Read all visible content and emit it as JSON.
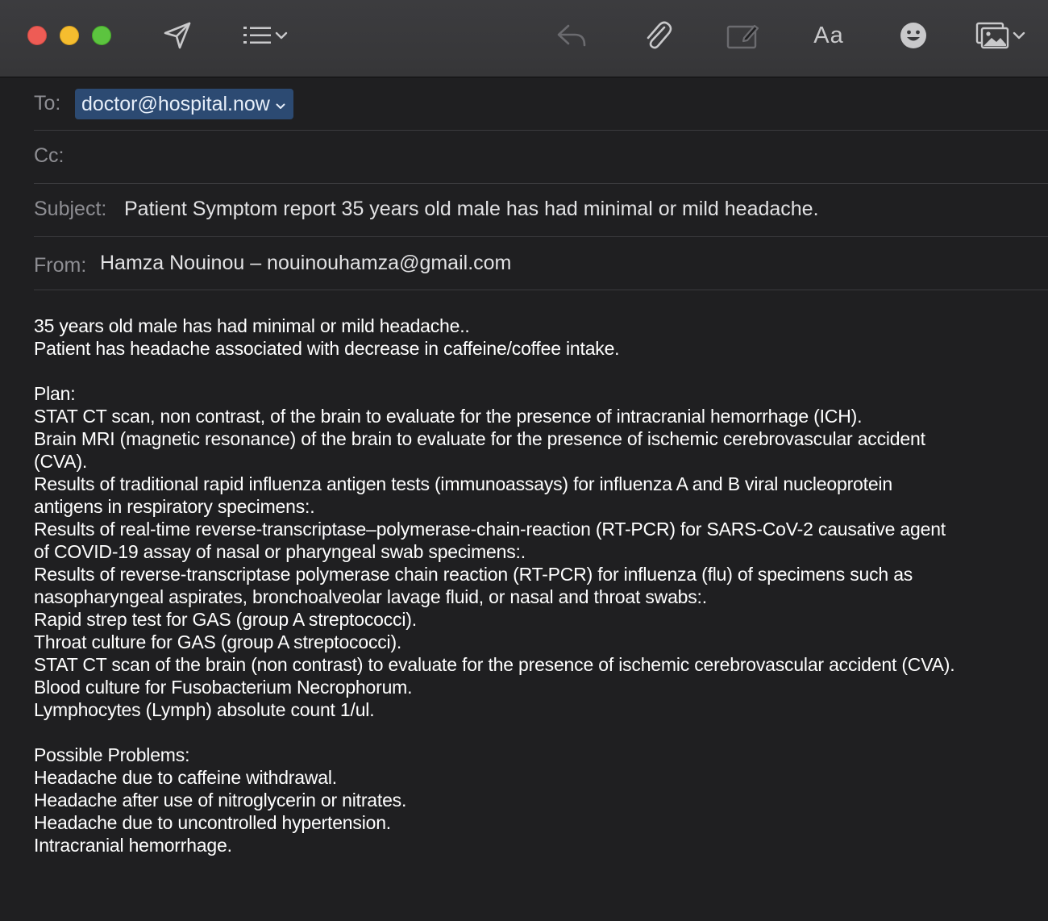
{
  "window": {
    "traffic_lights": {
      "close_color": "#ee5c55",
      "minimize_color": "#f5bd2f",
      "zoom_color": "#5cc43f"
    }
  },
  "toolbar": {
    "icons": [
      "send-icon",
      "list-icon",
      "reply-icon",
      "attachment-icon",
      "markup-icon",
      "format-icon",
      "emoji-icon",
      "photo-browser-icon"
    ],
    "format_label": "Aa"
  },
  "header": {
    "to_label": "To:",
    "to_value": "doctor@hospital.now",
    "cc_label": "Cc:",
    "cc_value": "",
    "subject_label": "Subject:",
    "subject_value": "Patient Symptom report 35 years old male has had minimal or mild headache.",
    "from_label": "From:",
    "from_value": "Hamza Nouinou – nouinouhamza@gmail.com"
  },
  "body": {
    "intro": [
      "35 years old male has had minimal or mild headache..",
      "Patient has headache associated with decrease in caffeine/coffee intake."
    ],
    "plan_heading": "Plan:",
    "plan_lines": [
      "STAT CT scan, non contrast, of the brain to evaluate for the presence of intracranial hemorrhage (ICH).",
      "Brain MRI (magnetic resonance) of the brain to evaluate for the presence of ischemic cerebrovascular accident",
      "(CVA).",
      "Results of traditional rapid influenza antigen tests (immunoassays) for influenza A and B viral nucleoprotein",
      "antigens in respiratory specimens:.",
      "Results of real-time reverse-transcriptase–polymerase-chain-reaction (RT-PCR) for SARS-CoV-2 causative agent",
      "of COVID-19 assay of nasal or pharyngeal swab specimens:.",
      "Results of reverse-transcriptase polymerase chain reaction (RT-PCR) for influenza (flu) of specimens such as",
      "nasopharyngeal aspirates, bronchoalveolar lavage fluid, or nasal and throat swabs:.",
      "Rapid strep test for GAS (group A streptococci).",
      "Throat culture for GAS (group A streptococci).",
      "STAT CT scan of the brain (non contrast) to evaluate for the presence of ischemic cerebrovascular accident (CVA).",
      "Blood culture for Fusobacterium Necrophorum.",
      "Lymphocytes (Lymph) absolute count 1/ul."
    ],
    "problems_heading": "Possible Problems:",
    "problems_lines": [
      "Headache due to caffeine withdrawal.",
      "Headache after use of nitroglycerin or nitrates.",
      "Headache due to uncontrolled hypertension.",
      "Intracranial hemorrhage."
    ]
  }
}
